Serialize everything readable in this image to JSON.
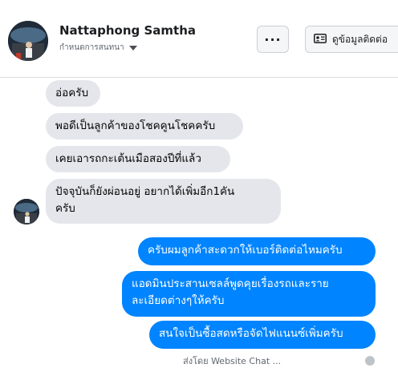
{
  "header": {
    "name": "Nattaphong Samtha",
    "subtitle": "กำหนดการสนทนา",
    "more_label": "···",
    "contact_label": "ดูข้อมูลติดต่อ"
  },
  "messages": [
    {
      "side": "in",
      "text": "อ่อครับ"
    },
    {
      "side": "in",
      "text": "พอดีเป็นลูกค้าของโชคคูนโชคครับ"
    },
    {
      "side": "in",
      "text": "เคยเอารถกะเต้นเมือสองปีที่แล้ว"
    },
    {
      "side": "in",
      "line1": "ปัจจุบันก็ยังผ่อนอยู่ อยากได้เพิ่มอีก1คัน",
      "line2": "ครับ"
    },
    {
      "side": "out",
      "text": "ครับผมลูกค้าสะดวกให้เบอร์ติดต่อไหมครับ"
    },
    {
      "side": "out",
      "line1": "แอดมินประสานเซลล์พูดคุยเรื่องรถและราย",
      "line2": "ละเอียดต่างๆให้ครับ"
    },
    {
      "side": "out",
      "text": "สนใจเป็นซื้อสดหรือจัดไฟแนนซ์เพิ่มครับ"
    }
  ],
  "status_text": "ส่งโดย Website Chat ...",
  "colors": {
    "outgoing": "#0084ff",
    "incoming": "#e4e6eb"
  }
}
